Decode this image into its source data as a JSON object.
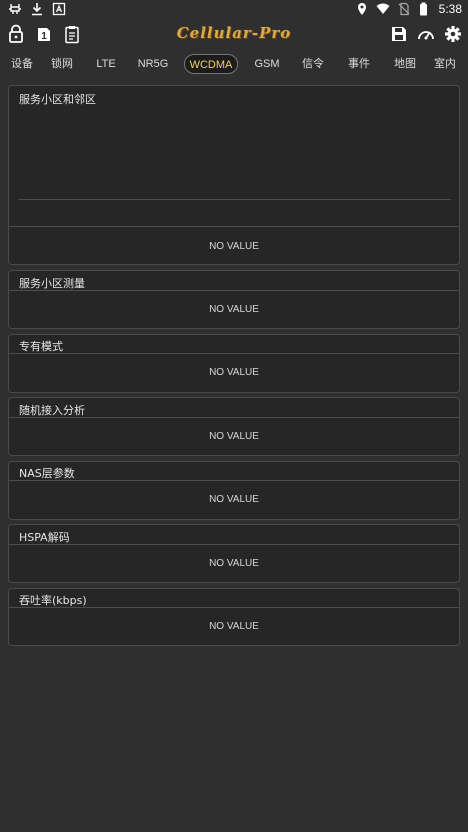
{
  "status_bar": {
    "time": "5:38",
    "left_icons": [
      "usb-debug-icon",
      "download-icon",
      "notification-a-icon"
    ],
    "right_icons": [
      "location-icon",
      "wifi-icon",
      "no-sim-icon",
      "battery-icon"
    ]
  },
  "toolbar": {
    "app_title": "Cellular-Pro",
    "left_icons": [
      "lock-icon",
      "sim-1-icon",
      "clipboard-icon"
    ],
    "right_icons": [
      "save-icon",
      "speedometer-icon",
      "gear-icon"
    ]
  },
  "tabs": [
    {
      "label": "设备"
    },
    {
      "label": "锁网"
    },
    {
      "label": "LTE"
    },
    {
      "label": "NR5G"
    },
    {
      "label": "WCDMA",
      "active": true
    },
    {
      "label": "GSM"
    },
    {
      "label": "信令"
    },
    {
      "label": "事件"
    },
    {
      "label": "地图"
    },
    {
      "label": "室内"
    }
  ],
  "panels": [
    {
      "title": "服务小区和邻区",
      "value": "NO VALUE"
    },
    {
      "title": "服务小区测量",
      "value": "NO VALUE"
    },
    {
      "title": "专有模式",
      "value": "NO VALUE"
    },
    {
      "title": "随机接入分析",
      "value": "NO VALUE"
    },
    {
      "title": "NAS层参数",
      "value": "NO VALUE"
    },
    {
      "title": "HSPA解码",
      "value": "NO VALUE"
    },
    {
      "title": "吞吐率(kbps)",
      "value": "NO VALUE"
    }
  ],
  "colors": {
    "background": "#2f2f2f",
    "panel": "#262626",
    "accent": "#f0d060",
    "title_gold": "#d9a94a"
  }
}
